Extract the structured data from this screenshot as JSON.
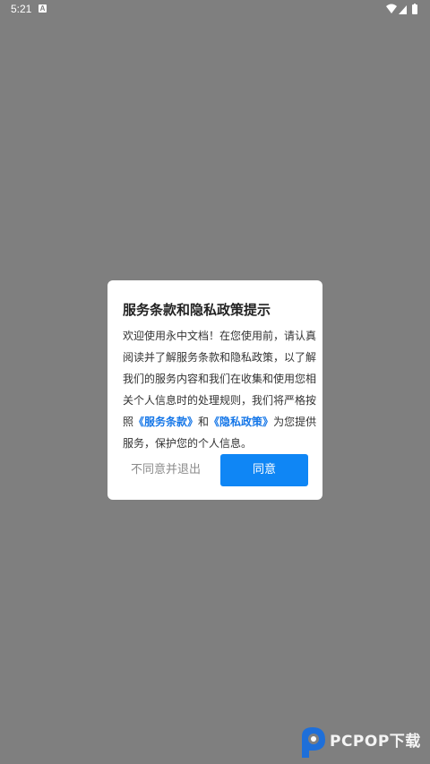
{
  "status_bar": {
    "time": "5:21",
    "notification_icon": "text-a-icon",
    "icons": [
      "wifi-icon",
      "cellular-signal-icon",
      "battery-icon"
    ]
  },
  "dialog": {
    "title": "服务条款和隐私政策提示",
    "body_lines": [
      "欢迎使用永中文档！在您使用前，请认真",
      "阅读并了解服务条款和隐私政策，以了解",
      "我们的服务内容和我们在收集和使用您相",
      "关个人信息时的处理规则，我们将严格按"
    ],
    "last_line_1_prefix": "照",
    "terms_link": "《服务条款》",
    "middle_word": "和",
    "privacy_link": "《隐私政策》",
    "last_line_1_suffix": "为您提供",
    "last_line_2": "服务，保护您的个人信息。",
    "decline_label": "不同意并退出",
    "agree_label": "同意"
  },
  "watermark": {
    "text": "PCPOP下载"
  },
  "colors": {
    "overlay": "#7f7f7f",
    "link": "#1677e8",
    "primary_button": "#0f86f5",
    "decline_text": "#8c8c8c"
  }
}
